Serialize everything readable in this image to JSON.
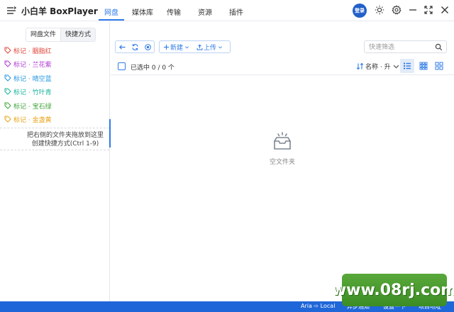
{
  "app": {
    "title": "小白羊 BoxPlayer"
  },
  "nav": {
    "tabs": [
      {
        "label": "网盘",
        "active": true
      },
      {
        "label": "媒体库"
      },
      {
        "label": "传输"
      },
      {
        "label": "资源"
      },
      {
        "label": "插件"
      }
    ]
  },
  "titlebar": {
    "login_label": "登录"
  },
  "sidebar": {
    "tabs": [
      {
        "label": "网盘文件"
      },
      {
        "label": "快捷方式",
        "active": true
      }
    ],
    "tags": [
      {
        "label": "标记 · 胭脂红",
        "color": "#e0463b"
      },
      {
        "label": "标记 · 兰花紫",
        "color": "#b03ad6"
      },
      {
        "label": "标记 · 晴空蓝",
        "color": "#2196e0"
      },
      {
        "label": "标记 · 竹叶青",
        "color": "#1ab39b"
      },
      {
        "label": "标记 · 宝石绿",
        "color": "#3fa53a"
      },
      {
        "label": "标记 · 金盏黄",
        "color": "#e7a317"
      }
    ],
    "hint_line1": "把右侧的文件夹拖放到这里",
    "hint_line2": "创建快捷方式(Ctrl 1-9)"
  },
  "toolbar": {
    "new_label": "新建",
    "upload_label": "上传",
    "search_placeholder": "快速筛选"
  },
  "list": {
    "selection_text": "已选中 0 / 0 个",
    "sort_label": "名称 · 升"
  },
  "empty": {
    "text": "空文件夹"
  },
  "statusbar": {
    "aria": "Aria ⇨ Local",
    "items": [
      "异步通知",
      "设置一下",
      "项目地址"
    ]
  },
  "watermark": {
    "text": "www.08rj.com"
  },
  "colors": {
    "accent": "#2f7be8",
    "statusbar": "#1f67d8",
    "login": "#2260c9"
  }
}
